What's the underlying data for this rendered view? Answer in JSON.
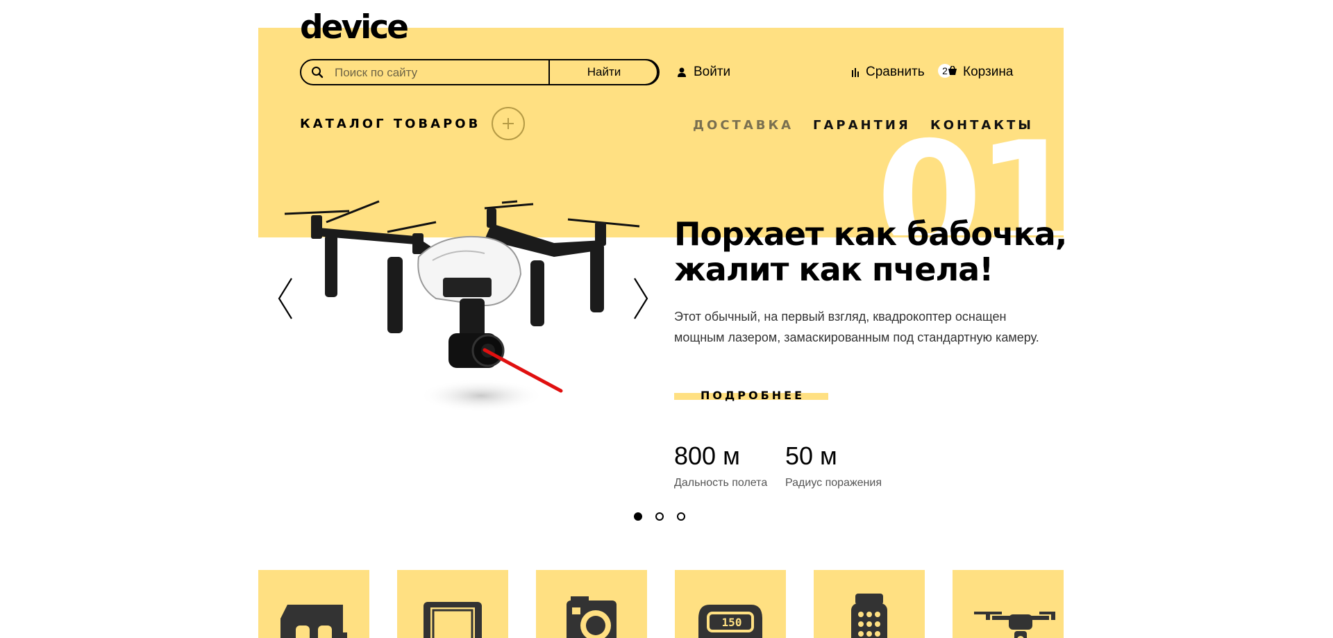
{
  "header": {
    "logo": "device",
    "search": {
      "placeholder": "Поиск по сайту",
      "button": "Найти"
    },
    "login": "Войти",
    "compare": "Сравнить",
    "cart": {
      "label": "Корзина",
      "count": "2"
    }
  },
  "nav": {
    "catalog": "КАТАЛОГ ТОВАРОВ",
    "items": [
      "ДОСТАВКА",
      "ГАРАНТИЯ",
      "КОНТАКТЫ"
    ]
  },
  "slider": {
    "number": "01",
    "headline_line1": "Порхает как бабочка,",
    "headline_line2": "жалит как пчела!",
    "description_line1": "Этот обычный, на первый взгляд, квадрокоптер оснащен",
    "description_line2": "мощным лазером, замаскированным под стандартную камеру.",
    "more_button": "ПОДРОБНЕЕ",
    "stats": [
      {
        "value": "800 м",
        "caption": "Дальность полета"
      },
      {
        "value": "50 м",
        "caption": "Радиус поражения"
      }
    ],
    "active_dot": 1,
    "dot_count": 3
  },
  "categories": [
    {
      "icon": "vr-headset-icon"
    },
    {
      "icon": "tablet-icon"
    },
    {
      "icon": "action-camera-icon"
    },
    {
      "icon": "fitness-band-icon",
      "screen_text": "150"
    },
    {
      "icon": "smartwatch-icon"
    },
    {
      "icon": "drone-icon"
    }
  ],
  "colors": {
    "accent": "#ffe082",
    "text": "#000000",
    "laser": "#e01010"
  }
}
